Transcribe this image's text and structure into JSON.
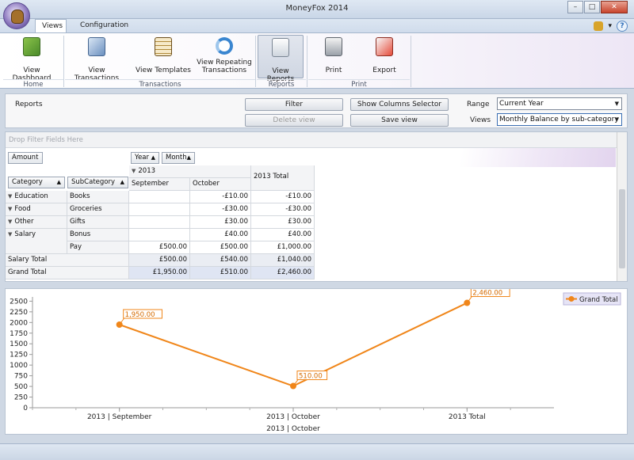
{
  "window": {
    "title": "MoneyFox 2014"
  },
  "tabs": [
    {
      "label": "Views"
    },
    {
      "label": "Configuration"
    }
  ],
  "help": {
    "icon": "question-icon",
    "theme_icon": "theme-brush-icon"
  },
  "ribbon": {
    "buttons": [
      {
        "label": "View Dashboard",
        "icon": "dashboard-icon"
      },
      {
        "label": "View Transactions",
        "icon": "transactions-icon"
      },
      {
        "label": "View Templates",
        "icon": "templates-icon"
      },
      {
        "label": "View Repeating Transactions",
        "icon": "repeat-icon"
      },
      {
        "label": "View Reports",
        "icon": "reports-icon"
      },
      {
        "label": "Print",
        "icon": "printer-icon"
      },
      {
        "label": "Export",
        "icon": "export-icon"
      }
    ],
    "groups": [
      {
        "label": "Home"
      },
      {
        "label": "Transactions"
      },
      {
        "label": "Reports"
      },
      {
        "label": "Print"
      }
    ]
  },
  "reports": {
    "title": "Reports",
    "filter_label": "Filter",
    "delete_view_label": "Delete view",
    "show_columns_label": "Show Columns Selector",
    "save_view_label": "Save view",
    "range_label": "Range",
    "range_value": "Current Year",
    "views_label": "Views",
    "views_value": "Monthly Balance by sub-category"
  },
  "pivot": {
    "drop_filter": "Drop Filter Fields Here",
    "data_field": "Amount",
    "column_fields": [
      "Year",
      "Month"
    ],
    "row_fields": [
      "Category",
      "SubCategory"
    ],
    "year": "2013",
    "months": [
      "September",
      "October"
    ],
    "year_total_header": "2013 Total",
    "rows": [
      {
        "category": "Education",
        "subcategory": "Books",
        "september": "",
        "october": "-£10.00",
        "total": "-£10.00"
      },
      {
        "category": "Food",
        "subcategory": "Groceries",
        "september": "",
        "october": "-£30.00",
        "total": "-£30.00"
      },
      {
        "category": "Other",
        "subcategory": "Gifts",
        "september": "",
        "october": "£30.00",
        "total": "£30.00"
      },
      {
        "category": "Salary",
        "subcategory": "Bonus",
        "september": "",
        "october": "£40.00",
        "total": "£40.00"
      },
      {
        "category": "",
        "subcategory": "Pay",
        "september": "£500.00",
        "october": "£500.00",
        "total": "£1,000.00"
      }
    ],
    "salary_total": {
      "label": "Salary Total",
      "september": "£500.00",
      "october": "£540.00",
      "total": "£1,040.00"
    },
    "grand_total": {
      "label": "Grand Total",
      "september": "£1,950.00",
      "october": "£510.00",
      "total": "£2,460.00"
    }
  },
  "chart_data": {
    "type": "line",
    "categories": [
      "2013 | September",
      "2013 | October",
      "2013 Total"
    ],
    "series": [
      {
        "name": "Grand Total",
        "values": [
          1950,
          510,
          2460
        ],
        "labels": [
          "1,950.00",
          "510.00",
          "2,460.00"
        ],
        "color": "#f0861a"
      }
    ],
    "yticks": [
      0,
      250,
      500,
      750,
      1000,
      1250,
      1500,
      1750,
      2000,
      2250,
      2500
    ],
    "ylim": [
      0,
      2600
    ],
    "xlabel": "2013 | October",
    "legend_position": "top-right",
    "grid": false
  }
}
